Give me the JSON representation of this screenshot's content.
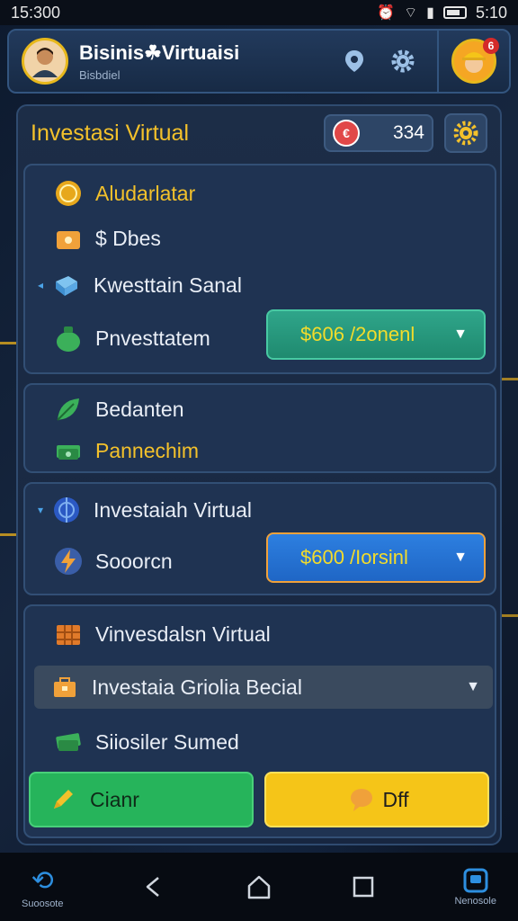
{
  "status_bar": {
    "time": "15:300",
    "right_time": "5:10"
  },
  "header": {
    "title": "Bisinis☘Virtuaisi",
    "subtitle": "Bisbdiel",
    "notif_count": "6"
  },
  "panel": {
    "title": "Investasi Virtual",
    "coin_value": "334",
    "coin_badge": "€"
  },
  "section1": {
    "items": [
      {
        "label": "Aludarlatar"
      },
      {
        "label": "$ Dbes"
      },
      {
        "label": "Kwesttain Sanal"
      },
      {
        "label": "Pnvesttatem"
      }
    ],
    "select_value": "$606 /2onenl"
  },
  "section2": {
    "items": [
      {
        "label": "Bedanten"
      },
      {
        "label": "Pannechim"
      }
    ]
  },
  "section3": {
    "items": [
      {
        "label": "Investaiah Virtual"
      },
      {
        "label": "Sooorcn"
      }
    ],
    "select_value": "$600 /Iorsinl"
  },
  "section4": {
    "items": [
      {
        "label": "Vinvesdalsn Virtual"
      },
      {
        "label": "Investaia Griolia Becial"
      },
      {
        "label": "Siiosiler Sumed"
      }
    ],
    "btn_left": "Cianr",
    "btn_right": "Dff"
  },
  "navbar": {
    "left_label": "Suoosote",
    "right_label": "Nenosole"
  }
}
